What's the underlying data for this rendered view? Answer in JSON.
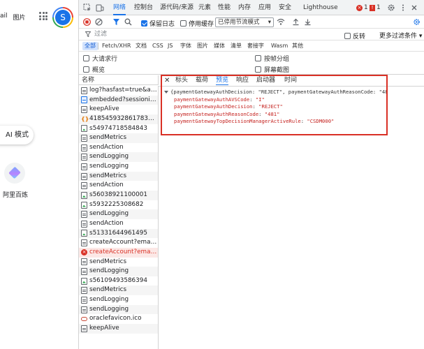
{
  "page": {
    "nav_links": [
      "ail",
      "图片"
    ],
    "avatar_letter": "S",
    "ai_mode_label": "AI 模式",
    "shortcut_label": "阿里百炼"
  },
  "devtools": {
    "tabs": [
      {
        "label": "网络",
        "active": true
      },
      {
        "label": "控制台"
      },
      {
        "label": "源代码/来源"
      },
      {
        "label": "元素"
      },
      {
        "label": "性能"
      },
      {
        "label": "内存"
      },
      {
        "label": "应用"
      },
      {
        "label": "安全"
      },
      {
        "label": "Lighthouse"
      }
    ],
    "error_count": "1",
    "warning_count": "1",
    "preserve_log_label": "保留日志",
    "disable_cache_label": "停用缓存",
    "throttle_value": "已停用节流模式",
    "filter_placeholder": "过滤",
    "invert_label": "反转",
    "more_filters_label": "更多过滤条件",
    "type_filters": [
      "全部",
      "Fetch/XHR",
      "文档",
      "CSS",
      "JS",
      "字体",
      "图片",
      "媒体",
      "清单",
      "套接字",
      "Wasm",
      "其他"
    ],
    "options": {
      "large_rows": "大请求行",
      "group_by_frame": "按帧分组",
      "overview": "概览",
      "screenshots": "屏幕截图"
    },
    "list_header": "名称",
    "requests": [
      {
        "name": "log?hasfast=true&auth...",
        "icon": "doc"
      },
      {
        "name": "embedded?sessionid=...",
        "icon": "xhr"
      },
      {
        "name": "keepAlive",
        "icon": "doc"
      },
      {
        "name": "418545932861783703...",
        "icon": "js"
      },
      {
        "name": "s54974718584843",
        "icon": "img"
      },
      {
        "name": "sendMetrics",
        "icon": "doc"
      },
      {
        "name": "sendAction",
        "icon": "doc"
      },
      {
        "name": "sendLogging",
        "icon": "doc"
      },
      {
        "name": "sendLogging",
        "icon": "doc"
      },
      {
        "name": "sendMetrics",
        "icon": "doc"
      },
      {
        "name": "sendAction",
        "icon": "doc"
      },
      {
        "name": "s56038921100001",
        "icon": "img"
      },
      {
        "name": "s5932225308682",
        "icon": "img"
      },
      {
        "name": "sendLogging",
        "icon": "doc"
      },
      {
        "name": "sendAction",
        "icon": "doc"
      },
      {
        "name": "s51331644961495",
        "icon": "img"
      },
      {
        "name": "createAccount?email=...",
        "icon": "doc"
      },
      {
        "name": "createAccount?email=...",
        "icon": "err",
        "error": true
      },
      {
        "name": "sendMetrics",
        "icon": "doc"
      },
      {
        "name": "sendLogging",
        "icon": "doc"
      },
      {
        "name": "s56109493586394",
        "icon": "img"
      },
      {
        "name": "sendMetrics",
        "icon": "doc"
      },
      {
        "name": "sendLogging",
        "icon": "doc"
      },
      {
        "name": "sendLogging",
        "icon": "doc"
      },
      {
        "name": "oraclefavicon.ico",
        "icon": "fav"
      },
      {
        "name": "keepAlive",
        "icon": "doc"
      }
    ],
    "detail_tabs": [
      {
        "label": "标头"
      },
      {
        "label": "载荷"
      },
      {
        "label": "预览",
        "active": true
      },
      {
        "label": "响应"
      },
      {
        "label": "启动器"
      },
      {
        "label": "时间"
      }
    ],
    "preview": {
      "summary": "{paymentGatewayAuthDecision: \"REJECT\", paymentGatewayAuthReasonCode: \"481\",…}",
      "fields": [
        {
          "key": "paymentGatewayAuthAVSCode",
          "value": "\"I\""
        },
        {
          "key": "paymentGatewayAuthDecision",
          "value": "\"REJECT\""
        },
        {
          "key": "paymentGatewayAuthReasonCode",
          "value": "\"481\""
        },
        {
          "key": "paymentGatewayTopDecisionManagerActiveRule",
          "value": "\"CSDM000\""
        }
      ]
    },
    "colors": {
      "accent": "#1a73e8",
      "error": "#d93025",
      "highlight_box": "#d93025"
    }
  }
}
